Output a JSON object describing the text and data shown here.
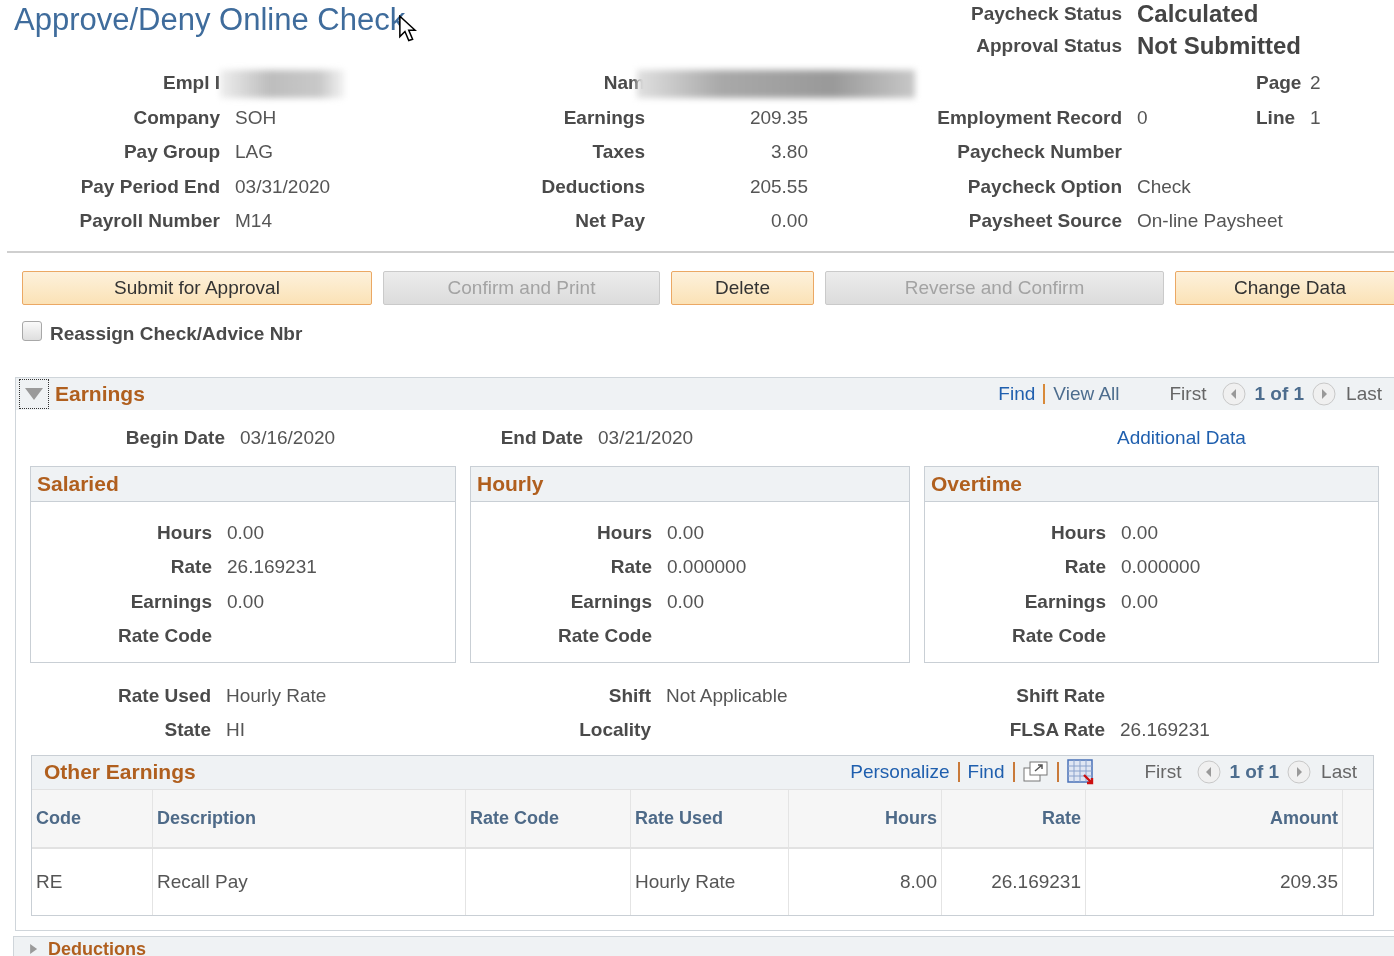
{
  "page_title": "Approve/Deny Online Check",
  "status": [
    {
      "label": "Paycheck Status",
      "value": "Calculated"
    },
    {
      "label": "Approval Status",
      "value": "Not Submitted"
    }
  ],
  "summary_rows": [
    {
      "left": {
        "label": "Empl I",
        "redacted": true
      },
      "middle": {
        "label": "Nam",
        "redacted": true
      },
      "far_right": {
        "label": "Page",
        "value": "2"
      }
    },
    {
      "left": {
        "label": "Company",
        "value": "SOH"
      },
      "middle": {
        "label": "Earnings",
        "value": "209.35"
      },
      "right": {
        "label": "Employment Record",
        "value": "0"
      },
      "far_right": {
        "label": "Line",
        "value": "1"
      }
    },
    {
      "left": {
        "label": "Pay Group",
        "value": "LAG"
      },
      "middle": {
        "label": "Taxes",
        "value": "3.80"
      },
      "right": {
        "label": "Paycheck Number"
      }
    },
    {
      "left": {
        "label": "Pay Period End",
        "value": "03/31/2020"
      },
      "middle": {
        "label": "Deductions",
        "value": "205.55"
      },
      "right": {
        "label": "Paycheck Option",
        "value": "Check"
      }
    },
    {
      "left": {
        "label": "Payroll Number",
        "value": "M14"
      },
      "middle": {
        "label": "Net Pay",
        "value": "0.00"
      },
      "right": {
        "label": "Paysheet Source",
        "value": "On-line Paysheet"
      }
    }
  ],
  "buttons": [
    {
      "label": "Submit for Approval",
      "disabled": false
    },
    {
      "label": "Confirm and Print",
      "disabled": true
    },
    {
      "label": "Delete",
      "disabled": false
    },
    {
      "label": "Reverse and Confirm",
      "disabled": true
    },
    {
      "label": "Change Data",
      "disabled": false
    }
  ],
  "reassign": {
    "label": "Reassign Check/Advice Nbr",
    "checked": false
  },
  "earnings": {
    "title": "Earnings",
    "expanded": true,
    "toolbar": {
      "find": "Find",
      "view_all": "View All",
      "first": "First",
      "position": "1 of 1",
      "last": "Last"
    },
    "dates": [
      {
        "label": "Begin Date",
        "value": "03/16/2020"
      },
      {
        "label": "End Date",
        "value": "03/21/2020"
      }
    ],
    "additional_link": "Additional Data",
    "panels": [
      {
        "title": "Salaried",
        "fields": [
          {
            "label": "Hours",
            "value": "0.00"
          },
          {
            "label": "Rate",
            "value": "26.169231"
          },
          {
            "label": "Earnings",
            "value": "0.00"
          },
          {
            "label": "Rate Code"
          }
        ]
      },
      {
        "title": "Hourly",
        "fields": [
          {
            "label": "Hours",
            "value": "0.00"
          },
          {
            "label": "Rate",
            "value": "0.000000"
          },
          {
            "label": "Earnings",
            "value": "0.00"
          },
          {
            "label": "Rate Code"
          }
        ]
      },
      {
        "title": "Overtime",
        "fields": [
          {
            "label": "Hours",
            "value": "0.00"
          },
          {
            "label": "Rate",
            "value": "0.000000"
          },
          {
            "label": "Earnings",
            "value": "0.00"
          },
          {
            "label": "Rate Code"
          }
        ]
      }
    ],
    "details": [
      {
        "fields": [
          {
            "label": "Rate Used",
            "value": "Hourly Rate"
          },
          {
            "label": "Shift",
            "value": "Not Applicable"
          },
          {
            "label": "Shift Rate"
          }
        ]
      },
      {
        "fields": [
          {
            "label": "State",
            "value": "HI"
          },
          {
            "label": "Locality"
          },
          {
            "label": "FLSA Rate",
            "value": "26.169231"
          }
        ]
      }
    ],
    "other_earnings": {
      "title": "Other Earnings",
      "toolbar": {
        "personalize": "Personalize",
        "find": "Find",
        "first": "First",
        "position": "1 of 1",
        "last": "Last"
      },
      "columns": [
        "Code",
        "Description",
        "Rate Code",
        "Rate Used",
        "Hours",
        "Rate",
        "Amount"
      ],
      "rows": [
        {
          "cells": [
            "RE",
            "Recall Pay",
            null,
            "Hourly Rate",
            "8.00",
            "26.169231",
            "209.35"
          ]
        }
      ]
    }
  },
  "deductions": {
    "title": "Deductions",
    "expanded": false
  }
}
